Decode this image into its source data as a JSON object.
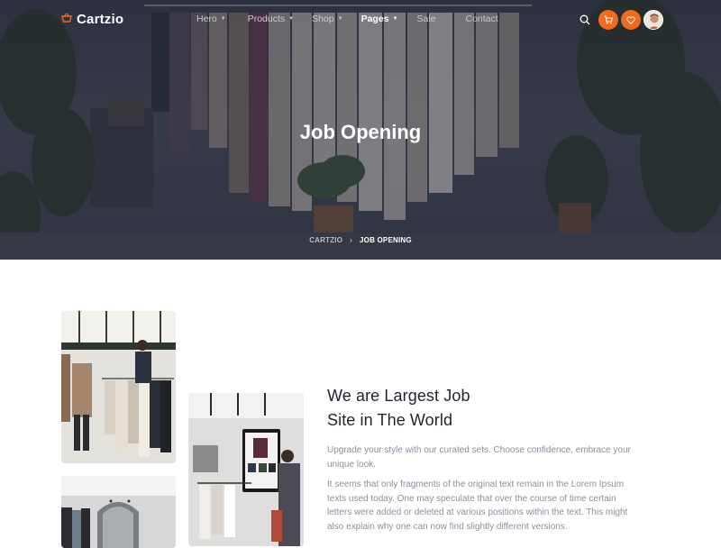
{
  "brand": {
    "name": "Cartzio",
    "accent": "#f26a1b"
  },
  "nav": {
    "items": [
      {
        "label": "Hero",
        "has_dropdown": true,
        "active": false
      },
      {
        "label": "Products",
        "has_dropdown": true,
        "active": false
      },
      {
        "label": "Shop",
        "has_dropdown": true,
        "active": false
      },
      {
        "label": "Pages",
        "has_dropdown": true,
        "active": true
      },
      {
        "label": "Sale",
        "has_dropdown": false,
        "active": false
      },
      {
        "label": "Contact",
        "has_dropdown": false,
        "active": false
      }
    ],
    "actions": {
      "search_icon": "search-icon",
      "cart_icon": "cart-icon",
      "wishlist_icon": "heart-icon",
      "avatar": "user-avatar"
    }
  },
  "hero": {
    "title": "Job Opening",
    "breadcrumb": {
      "home": "CARTZIO",
      "separator": "›",
      "current": "JOB OPENING"
    }
  },
  "content": {
    "heading_line1": "We are Largest Job",
    "heading_line2": "Site in The World",
    "lead": "Upgrade your style with our curated sets. Choose confidence, embrace your unique look.",
    "paragraph": "It seems that only fragments of the original text remain in the Lorem Ipsum texts used today. One may speculate that over the course of time certain letters were added or deleted at various positions within the text. This might also explain why one can now find slightly different versions."
  }
}
